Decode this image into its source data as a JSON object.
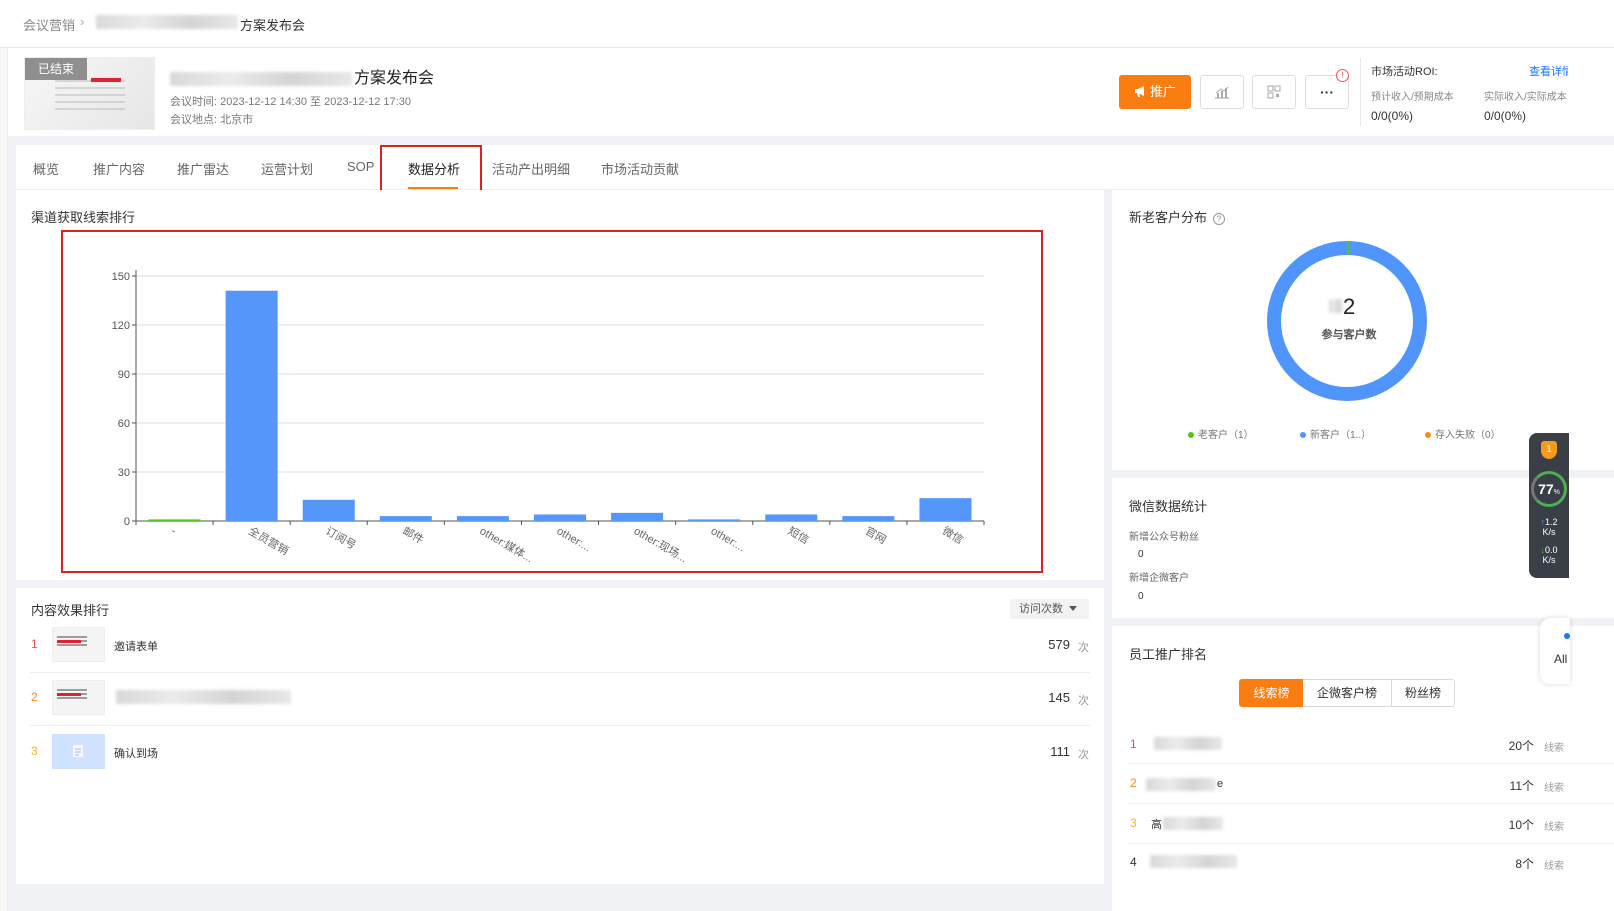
{
  "breadcrumb": {
    "root": "会议营销",
    "separator": "›",
    "current_suffix": "方案发布会"
  },
  "event": {
    "status_tag": "已结束",
    "title_suffix": "方案发布会",
    "time_label": "会议时间:",
    "time_value": "2023-12-12 14:30 至 2023-12-12 17:30",
    "location_label": "会议地点:",
    "location_value": "北京市"
  },
  "actions": {
    "promote": "推广",
    "more": "···",
    "warn": "!"
  },
  "roi": {
    "label": "市场活动ROI:",
    "detail_link": "查看详情",
    "expected_label": "预计收入/预期成本",
    "expected_value": "0/0(0%)",
    "actual_label": "实际收入/实际成本",
    "actual_value": "0/0(0%)"
  },
  "tabs": [
    {
      "label": "概览"
    },
    {
      "label": "推广内容"
    },
    {
      "label": "推广雷达"
    },
    {
      "label": "运营计划"
    },
    {
      "label": "SOP"
    },
    {
      "label": "数据分析"
    },
    {
      "label": "活动产出明细"
    },
    {
      "label": "市场活动贡献"
    }
  ],
  "active_tab": "数据分析",
  "channel_panel": {
    "title": "渠道获取线索排行"
  },
  "chart_data": {
    "type": "bar",
    "title": "",
    "xlabel": "",
    "ylabel": "",
    "ylim": [
      0,
      150
    ],
    "yticks": [
      0,
      30,
      60,
      90,
      120,
      150
    ],
    "grid": true,
    "categories": [
      "-",
      "全员营销",
      "订阅号",
      "邮件",
      "other:媒体...",
      "other:...",
      "other:现场...",
      "other:...",
      "短信",
      "官网",
      "微信"
    ],
    "values": [
      1,
      141,
      13,
      3,
      3,
      4,
      5,
      1,
      4,
      3,
      14
    ],
    "colors": {
      "primary": "#5596fb",
      "first": "#52c41a"
    }
  },
  "content_panel": {
    "title": "内容效果排行",
    "sort": "访问次数",
    "rows": [
      {
        "rank": "1",
        "name": "邀请表单",
        "count": "579",
        "unit": "次"
      },
      {
        "rank": "2",
        "name": "",
        "count": "145",
        "unit": "次"
      },
      {
        "rank": "3",
        "name": "确认到场",
        "count": "111",
        "unit": "次"
      }
    ]
  },
  "customer_panel": {
    "title": "新老客户分布",
    "help": "?",
    "center_value": "2",
    "center_label": "参与客户数",
    "legend": [
      {
        "label": "老客户（1）",
        "color": "#52c41a"
      },
      {
        "label": "新客户（1..）",
        "color": "#4f95fb"
      },
      {
        "label": "存入失败（0）",
        "color": "#fa8c16"
      }
    ],
    "share": {
      "old": 1,
      "new": 99
    }
  },
  "wechat_panel": {
    "title": "微信数据统计",
    "fans_label": "新增公众号粉丝",
    "fans_value": "0",
    "wecom_label": "新增企微客户",
    "wecom_value": "0"
  },
  "staff_panel": {
    "title": "员工推广排名",
    "segments": [
      "线索榜",
      "企微客户榜",
      "粉丝榜"
    ],
    "active_segment": "线索榜",
    "rows": [
      {
        "rank": "1",
        "name": "",
        "count": "20个",
        "unit": "线索"
      },
      {
        "rank": "2",
        "name": "e",
        "count": "11个",
        "unit": "线索"
      },
      {
        "rank": "3",
        "name": "高",
        "count": "10个",
        "unit": "线索"
      },
      {
        "rank": "4",
        "name": "",
        "count": "8个",
        "unit": "线索"
      }
    ]
  },
  "net_monitor": {
    "badge": "1",
    "percent": "77",
    "percent_unit": "%",
    "up": "1.2",
    "up_unit": "K/s",
    "down": "0.0",
    "down_unit": "K/s",
    "up_arrow": "↑",
    "down_arrow": "↓"
  },
  "all_widget": {
    "label": "All"
  }
}
